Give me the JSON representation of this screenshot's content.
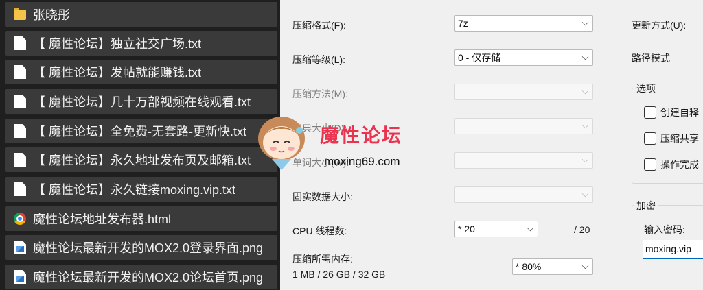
{
  "files": [
    {
      "icon": "folder-icon",
      "label": "张晓彤"
    },
    {
      "icon": "text-file-icon",
      "label": "【 魔性论坛】独立社交广场.txt"
    },
    {
      "icon": "text-file-icon",
      "label": "【 魔性论坛】发帖就能赚钱.txt"
    },
    {
      "icon": "text-file-icon",
      "label": "【 魔性论坛】几十万部视频在线观看.txt"
    },
    {
      "icon": "text-file-icon",
      "label": "【 魔性论坛】全免费-无套路-更新快.txt"
    },
    {
      "icon": "text-file-icon",
      "label": "【 魔性论坛】永久地址发布页及邮箱.txt"
    },
    {
      "icon": "text-file-icon",
      "label": "【 魔性论坛】永久链接moxing.vip.txt"
    },
    {
      "icon": "chrome-icon",
      "label": "魔性论坛地址发布器.html"
    },
    {
      "icon": "image-file-icon",
      "label": "魔性论坛最新开发的MOX2.0登录界面.png"
    },
    {
      "icon": "image-file-icon",
      "label": "魔性论坛最新开发的MOX2.0论坛首页.png"
    }
  ],
  "dialog": {
    "format_label": "压缩格式(F):",
    "format_value": "7z",
    "level_label": "压缩等级(L):",
    "level_value": "0 - 仅存储",
    "method_label": "压缩方法(M):",
    "dict_label": "字典大小(D):",
    "word_label": "单词大小(W):",
    "solid_label": "固实数据大小:",
    "threads_label": "CPU 线程数:",
    "threads_value": "* 20",
    "threads_max": "/ 20",
    "memory_label": "压缩所需内存:",
    "memory_value": "1 MB / 26 GB / 32 GB",
    "memory_pct": "* 80%",
    "update_label": "更新方式(U):",
    "path_label": "路径模式",
    "options_legend": "选项",
    "opt1": "创建自释",
    "opt2": "压缩共享",
    "opt3": "操作完成",
    "encrypt_legend": "加密",
    "password_label": "输入密码:",
    "password_value": "moxing.vip"
  },
  "watermark": {
    "title": "魔性论坛",
    "url": "moxing69.com"
  }
}
